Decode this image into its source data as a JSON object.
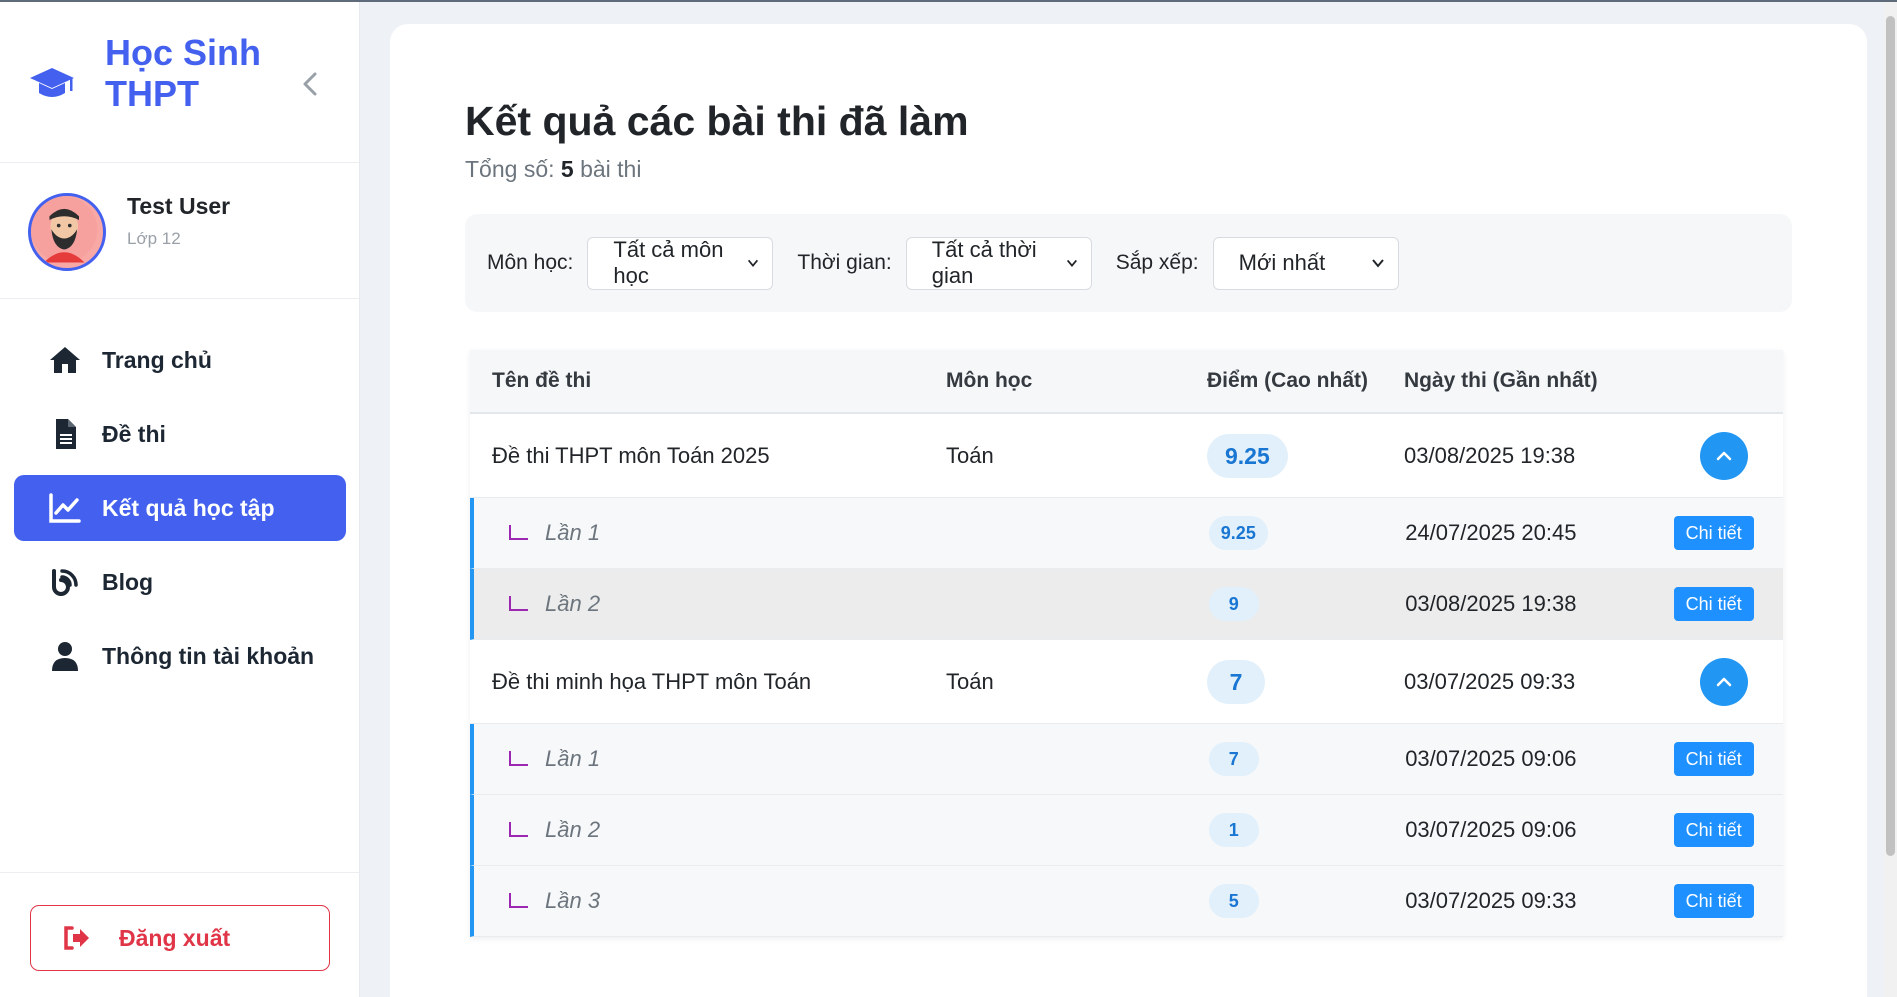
{
  "brand": {
    "title": "Học Sinh THPT"
  },
  "user": {
    "name": "Test User",
    "class": "Lớp 12"
  },
  "nav": [
    {
      "label": "Trang chủ",
      "icon": "home-icon",
      "active": false
    },
    {
      "label": "Đề thi",
      "icon": "document-icon",
      "active": false
    },
    {
      "label": "Kết quả học tập",
      "icon": "chart-line-icon",
      "active": true
    },
    {
      "label": "Blog",
      "icon": "blog-icon",
      "active": false
    },
    {
      "label": "Thông tin tài khoản",
      "icon": "user-icon",
      "active": false
    }
  ],
  "logout": {
    "label": "Đăng xuất"
  },
  "page": {
    "title": "Kết quả các bài thi đã làm",
    "subtitle_prefix": "Tổng số:",
    "count": "5",
    "subtitle_suffix": "bài thi"
  },
  "filters": {
    "subject_label": "Môn học:",
    "subject_value": "Tất cả môn học",
    "time_label": "Thời gian:",
    "time_value": "Tất cả thời gian",
    "sort_label": "Sắp xếp:",
    "sort_value": "Mới nhất"
  },
  "table": {
    "headers": [
      "Tên đề thi",
      "Môn học",
      "Điểm (Cao nhất)",
      "Ngày thi (Gần nhất)"
    ],
    "exams": [
      {
        "name": "Đề thi THPT môn Toán 2025",
        "subject": "Toán",
        "score": "9.25",
        "date": "03/08/2025 19:38",
        "attempts": [
          {
            "label": "Lần 1",
            "score": "9.25",
            "date": "24/07/2025 20:45",
            "action": "Chi tiết"
          },
          {
            "label": "Lần 2",
            "score": "9",
            "date": "03/08/2025 19:38",
            "action": "Chi tiết"
          }
        ]
      },
      {
        "name": "Đề thi minh họa THPT môn Toán",
        "subject": "Toán",
        "score": "7",
        "date": "03/07/2025 09:33",
        "attempts": [
          {
            "label": "Lần 1",
            "score": "7",
            "date": "03/07/2025 09:06",
            "action": "Chi tiết"
          },
          {
            "label": "Lần 2",
            "score": "1",
            "date": "03/07/2025 09:06",
            "action": "Chi tiết"
          },
          {
            "label": "Lần 3",
            "score": "5",
            "date": "03/07/2025 09:33",
            "action": "Chi tiết"
          }
        ]
      }
    ]
  },
  "colors": {
    "accent": "#4361ee",
    "primary_blue": "#2196f3",
    "danger": "#e03547"
  }
}
